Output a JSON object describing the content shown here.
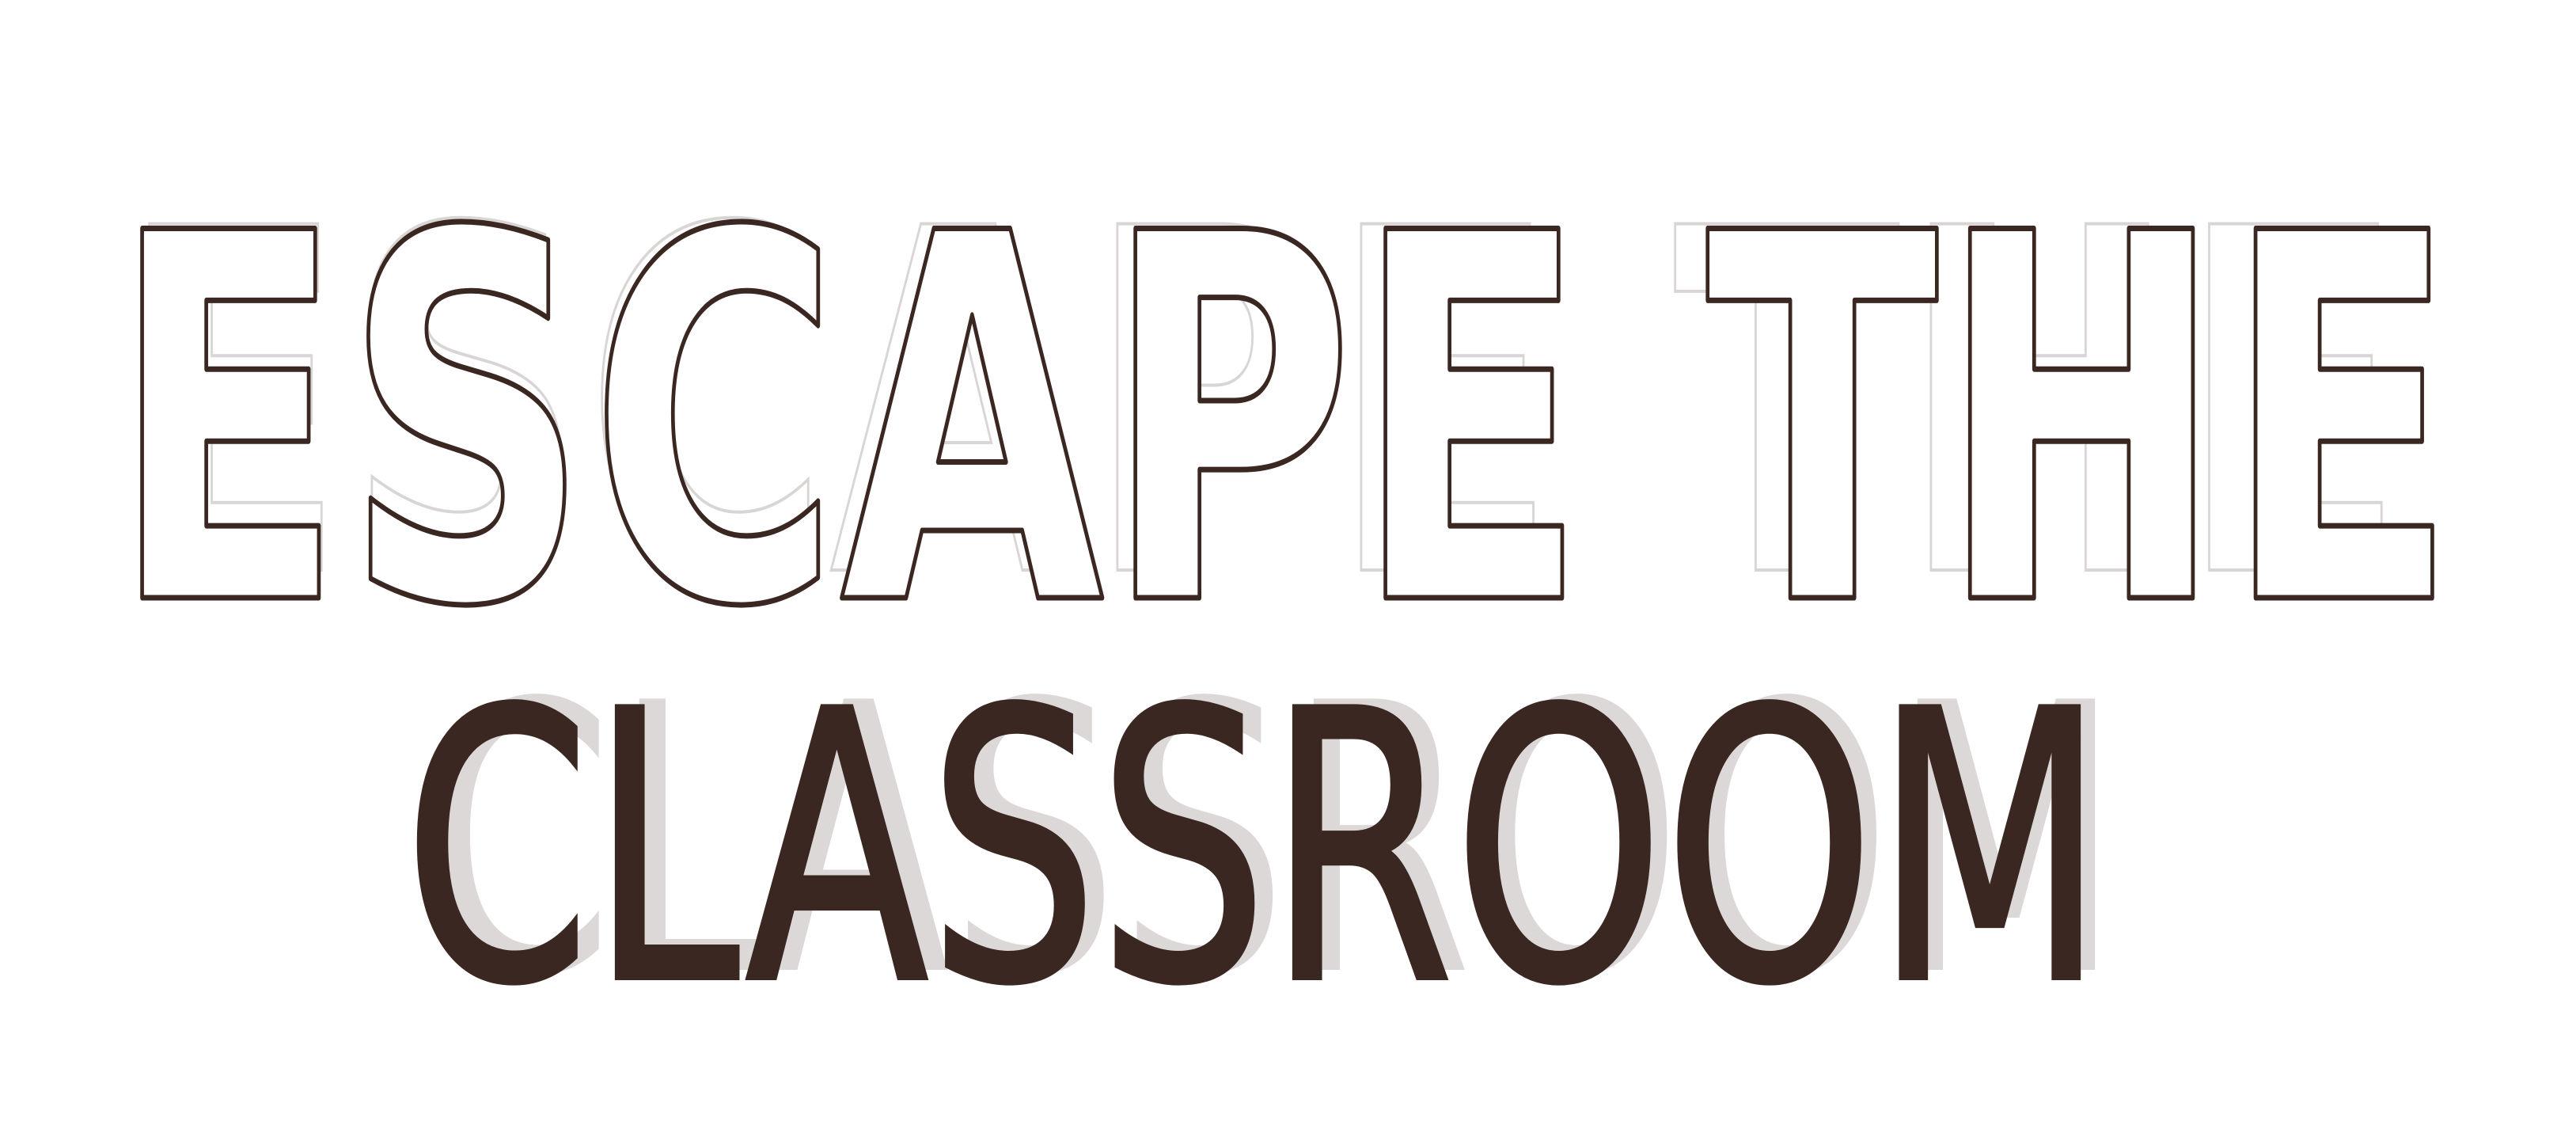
{
  "artwork": {
    "line_1": "ESCAPE THE",
    "line_2": "CLASSROOM",
    "colors": {
      "ink": "#3b2722",
      "sketch_guide": "#d9d5d4",
      "background": "#ffffff"
    }
  }
}
